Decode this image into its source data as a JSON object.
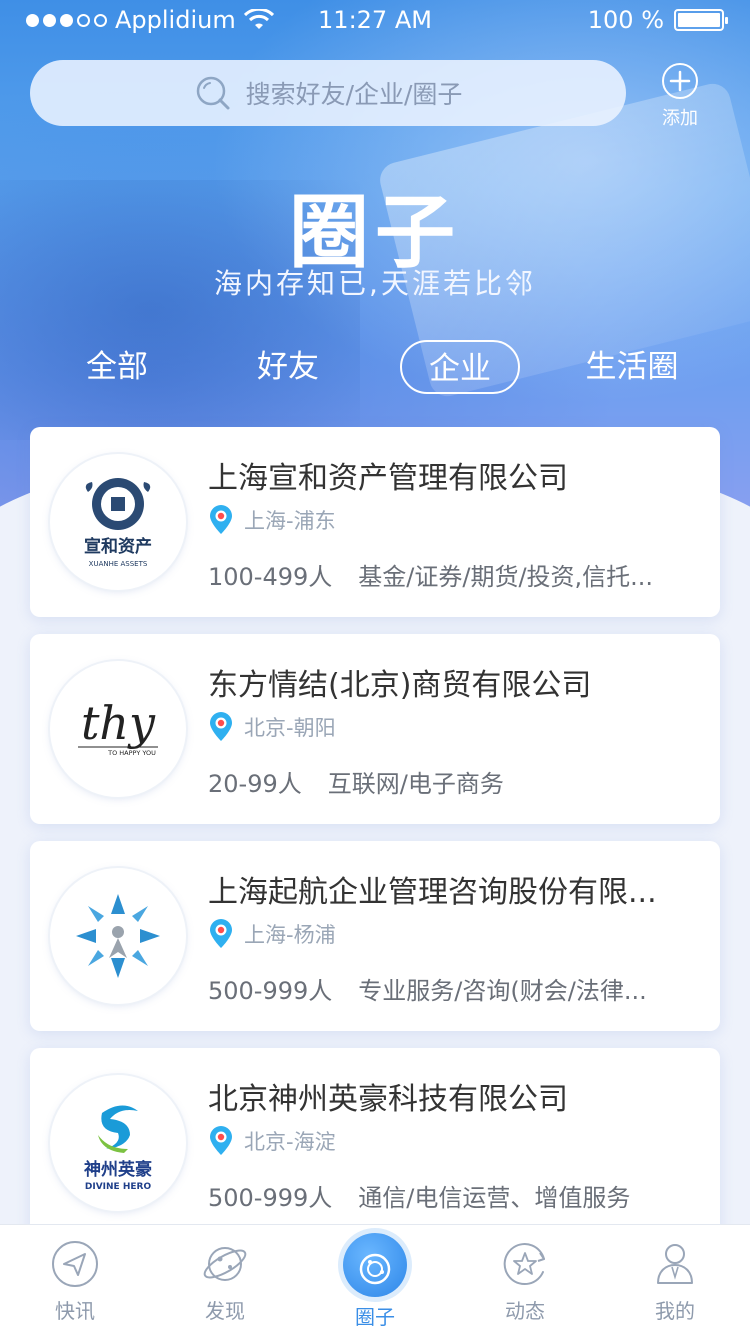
{
  "status_bar": {
    "carrier": "Applidium",
    "time": "11:27 AM",
    "battery": "100 %"
  },
  "search": {
    "placeholder": "搜索好友/企业/圈子",
    "add_label": "添加"
  },
  "hero": {
    "title": "圈子",
    "subtitle": "海内存知已,天涯若比邻"
  },
  "tabs": [
    {
      "label": "全部",
      "active": false
    },
    {
      "label": "好友",
      "active": false
    },
    {
      "label": "企业",
      "active": true
    },
    {
      "label": "生活圈",
      "active": false
    }
  ],
  "companies": [
    {
      "name": "上海宣和资产管理有限公司",
      "location": "上海-浦东",
      "size": "100-499人",
      "industry": "基金/证券/期货/投资,信托...",
      "logo_text": "宣和资产",
      "logo_subtext": "XUANHE ASSETS"
    },
    {
      "name": "东方情结(北京)商贸有限公司",
      "location": "北京-朝阳",
      "size": "20-99人",
      "industry": "互联网/电子商务",
      "logo_text": "thy",
      "logo_subtext": "TO HAPPY YOU"
    },
    {
      "name": "上海起航企业管理咨询股份有限...",
      "location": "上海-杨浦",
      "size": "500-999人",
      "industry": "专业服务/咨询(财会/法律...",
      "logo_text": "",
      "logo_subtext": ""
    },
    {
      "name": "北京神州英豪科技有限公司",
      "location": "北京-海淀",
      "size": "500-999人",
      "industry": "通信/电信运营、增值服务",
      "logo_text": "神州英豪",
      "logo_subtext": "DIVINE HERO"
    }
  ],
  "bottom_nav": [
    {
      "label": "快讯",
      "icon": "send-icon",
      "active": false
    },
    {
      "label": "发现",
      "icon": "planet-icon",
      "active": false
    },
    {
      "label": "圈子",
      "icon": "circle-icon",
      "active": true
    },
    {
      "label": "动态",
      "icon": "star-refresh-icon",
      "active": false
    },
    {
      "label": "我的",
      "icon": "user-icon",
      "active": false
    }
  ],
  "colors": {
    "accent": "#3a8ee6",
    "location_pin_outer": "#2fb0f0",
    "location_pin_inner": "#ff4d4d",
    "nav_inactive": "#8e9aac"
  }
}
